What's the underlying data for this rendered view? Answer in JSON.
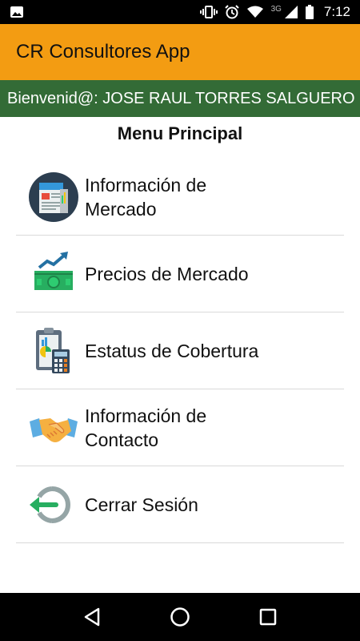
{
  "status_bar": {
    "time": "7:12",
    "network_type": "3G",
    "icons": [
      "image-notification-icon",
      "vibrate-icon",
      "alarm-icon",
      "wifi-icon",
      "signal-icon",
      "battery-icon"
    ]
  },
  "app_bar": {
    "title": "CR Consultores App"
  },
  "welcome": {
    "text": "Bienvenid@: JOSE RAUL TORRES SALGUERO"
  },
  "menu": {
    "title": "Menu Principal",
    "items": [
      {
        "label": "Información de Mercado",
        "icon": "news-icon"
      },
      {
        "label": "Precios de Mercado",
        "icon": "money-trend-icon"
      },
      {
        "label": "Estatus de Cobertura",
        "icon": "clipboard-calculator-icon"
      },
      {
        "label": "Información de Contacto",
        "icon": "handshake-icon"
      },
      {
        "label": "Cerrar Sesión",
        "icon": "logout-icon"
      }
    ]
  },
  "colors": {
    "app_bar": "#f39c12",
    "welcome_bar": "#336b36",
    "status_bar": "#000000"
  }
}
